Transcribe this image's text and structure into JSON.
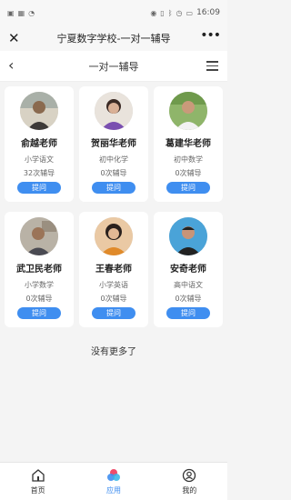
{
  "status_bar": {
    "time": "16:09",
    "battery": "",
    "left_icons": [
      "app-icon",
      "image-icon",
      "wifi-signal-icon"
    ],
    "right_icons": [
      "eye-icon",
      "vibrate-icon",
      "bluetooth-icon",
      "alarm-icon",
      "battery-icon"
    ]
  },
  "wechat_bar": {
    "title": "宁夏数字学校-一对一辅导",
    "close_label": "✕",
    "more_label": "•••"
  },
  "header": {
    "title": "一对一辅导",
    "back_label": "‹"
  },
  "teachers": [
    {
      "name": "俞越老师",
      "subject": "小学语文",
      "count": "32次辅导",
      "ask": "提问"
    },
    {
      "name": "贺丽华老师",
      "subject": "初中化学",
      "count": "0次辅导",
      "ask": "提问"
    },
    {
      "name": "葛建华老师",
      "subject": "初中数学",
      "count": "0次辅导",
      "ask": "提问"
    },
    {
      "name": "武卫民老师",
      "subject": "小学数学",
      "count": "0次辅导",
      "ask": "提问"
    },
    {
      "name": "王春老师",
      "subject": "小学英语",
      "count": "0次辅导",
      "ask": "提问"
    },
    {
      "name": "安奇老师",
      "subject": "高中语文",
      "count": "0次辅导",
      "ask": "提问"
    }
  ],
  "footer_text": "没有更多了",
  "tabs": [
    {
      "label": "首页",
      "icon": "home-icon"
    },
    {
      "label": "应用",
      "icon": "apps-icon"
    },
    {
      "label": "我的",
      "icon": "profile-icon"
    }
  ],
  "colors": {
    "accent": "#3f8ef0",
    "background": "#f4f4f4"
  }
}
